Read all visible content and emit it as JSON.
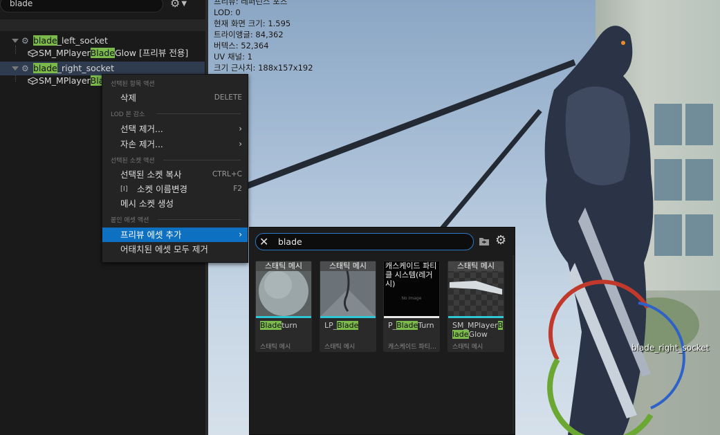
{
  "outliner": {
    "search_value": "blade",
    "rows": [
      {
        "pre": "",
        "hl": "blade",
        "post": "_left_socket"
      },
      {
        "pre": "SM_MPlayer",
        "hl": "Blade",
        "post": "Glow [프리뷰 전용]"
      },
      {
        "pre": "",
        "hl": "blade",
        "post": "_right_socket"
      },
      {
        "pre": "SM_MPlayer",
        "hl": "Bla",
        "post": ""
      }
    ]
  },
  "viewport": {
    "stats": [
      "프리뷰: 레퍼런스 포즈",
      "LOD: 0",
      "현재 화면 크기: 1.595",
      "트라이앵글: 84,362",
      "버텍스: 52,364",
      "UV 채널: 1",
      "크기 근사치: 188x157x192"
    ],
    "socket_label": "blade_right_socket"
  },
  "context_menu": {
    "sections": {
      "selected_actions": "선택된 항목 액션",
      "lod_reduction": "LOD 본 감소",
      "selected_socket_actions": "선택된 소켓 액션",
      "attached_asset_actions": "붙인 에셋 액션"
    },
    "items": {
      "delete": {
        "label": "삭제",
        "shortcut": "DELETE"
      },
      "remove_selected": {
        "label": "선택 제거..."
      },
      "remove_children": {
        "label": "자손 제거..."
      },
      "copy_sockets": {
        "label": "선택된 소켓 복사",
        "shortcut": "CTRL+C"
      },
      "rename_socket": {
        "label": "소켓 이름변경",
        "shortcut": "F2"
      },
      "create_mesh_socket": {
        "label": "메시 소켓 생성"
      },
      "add_preview_asset": {
        "label": "프리뷰 에셋 추가"
      },
      "remove_all_attached": {
        "label": "어태치된 에셋 모두 제거"
      }
    },
    "active_color": "#0e70c0"
  },
  "asset_picker": {
    "search_value": "blade",
    "assets": [
      {
        "badge": "스태틱 메시",
        "name_pre": "",
        "name_hl": "Blade",
        "name_post": "turn",
        "type": "스태틱 메시"
      },
      {
        "badge": "스태틱 메시",
        "name_pre": "LP_",
        "name_hl": "Blade",
        "name_post": "",
        "type": "스태틱 메시"
      },
      {
        "badge": "캐스케이드 파티클 시스템(레거시)",
        "name_pre": "P_",
        "name_hl": "Blade",
        "name_post": "Turn",
        "type": "캐스케이드 파티클 시스템 (레거시)",
        "thumb_text": "No Image"
      },
      {
        "badge": "스태틱 메시",
        "name_pre": "SM_MPlayer",
        "name_hl": "Blade",
        "name_post": "Glow",
        "type": "스태틱 메시"
      }
    ],
    "highlight_color": "#7ab94a"
  }
}
